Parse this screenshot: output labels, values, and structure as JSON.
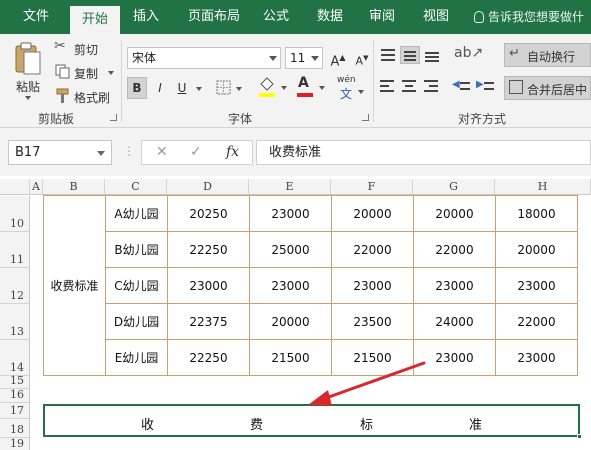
{
  "ribbon_tabs": [
    "文件",
    "开始",
    "插入",
    "页面布局",
    "公式",
    "数据",
    "审阅",
    "视图"
  ],
  "active_tab": "开始",
  "tell_me": "告诉我您想要做什",
  "clipboard": {
    "paste": "粘贴",
    "cut": "剪切",
    "copy": "复制",
    "format_painter": "格式刷",
    "label": "剪贴板"
  },
  "font": {
    "name": "宋体",
    "size": "11",
    "bold": "B",
    "italic": "I",
    "underline": "U",
    "wen": "wén",
    "wen_char": "文",
    "label": "字体"
  },
  "alignment": {
    "wrap_text": "自动换行",
    "merge_center": "合并后居中",
    "label": "对齐方式"
  },
  "formula_bar": {
    "name_box": "B17",
    "cancel": "✕",
    "enter": "✓",
    "fx": "fx",
    "formula": "收费标准"
  },
  "grid": {
    "columns": [
      "A",
      "B",
      "C",
      "D",
      "E",
      "F",
      "G",
      "H"
    ],
    "rows": [
      "10",
      "11",
      "12",
      "13",
      "14",
      "15",
      "16",
      "17",
      "18",
      "19"
    ],
    "merged_label": "收费标准",
    "table": [
      {
        "name": "A幼儿园",
        "values": [
          "20250",
          "23000",
          "20000",
          "20000",
          "18000"
        ]
      },
      {
        "name": "B幼儿园",
        "values": [
          "22250",
          "25000",
          "22000",
          "22000",
          "20000"
        ]
      },
      {
        "name": "C幼儿园",
        "values": [
          "23000",
          "23000",
          "23000",
          "23000",
          "23000"
        ]
      },
      {
        "name": "D幼儿园",
        "values": [
          "22375",
          "20000",
          "23500",
          "24000",
          "22000"
        ]
      },
      {
        "name": "E幼儿园",
        "values": [
          "22250",
          "21500",
          "21500",
          "23000",
          "23000"
        ]
      }
    ],
    "selected_text": [
      "收",
      "费",
      "标",
      "准"
    ]
  },
  "colors": {
    "excel_green": "#217346",
    "arrow_red": "#d9272e",
    "table_border": "#c6a271"
  }
}
